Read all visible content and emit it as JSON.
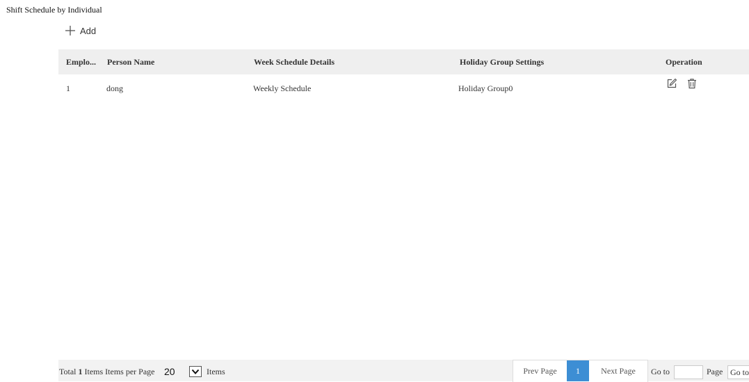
{
  "page": {
    "title": "Shift Schedule by Individual"
  },
  "toolbar": {
    "add_label": "Add",
    "add_icon": "plus-icon"
  },
  "table": {
    "headers": {
      "employee": "Emplo...",
      "person_name": "Person Name",
      "week_schedule": "Week Schedule Details",
      "holiday_group": "Holiday Group Settings",
      "operation": "Operation"
    },
    "rows": [
      {
        "employee": "1",
        "person_name": "dong",
        "week_schedule": "Weekly Schedule",
        "holiday_group": "Holiday Group0",
        "operations": [
          "edit-icon",
          "delete-icon"
        ]
      }
    ]
  },
  "footer": {
    "total_prefix": "Total ",
    "total_count": "1",
    "total_suffix": " Items Items per Page",
    "per_page_value": "20",
    "items_label": "Items",
    "prev_label": "Prev Page",
    "current_page": "1",
    "next_label": "Next Page",
    "goto_label": "Go to",
    "goto_value": "",
    "page_label": "Page",
    "goto_button": "Go to"
  },
  "colors": {
    "header_bg": "#efefef",
    "footer_bg": "#f2f2f2",
    "accent": "#3d8ed4",
    "text": "#333333"
  }
}
